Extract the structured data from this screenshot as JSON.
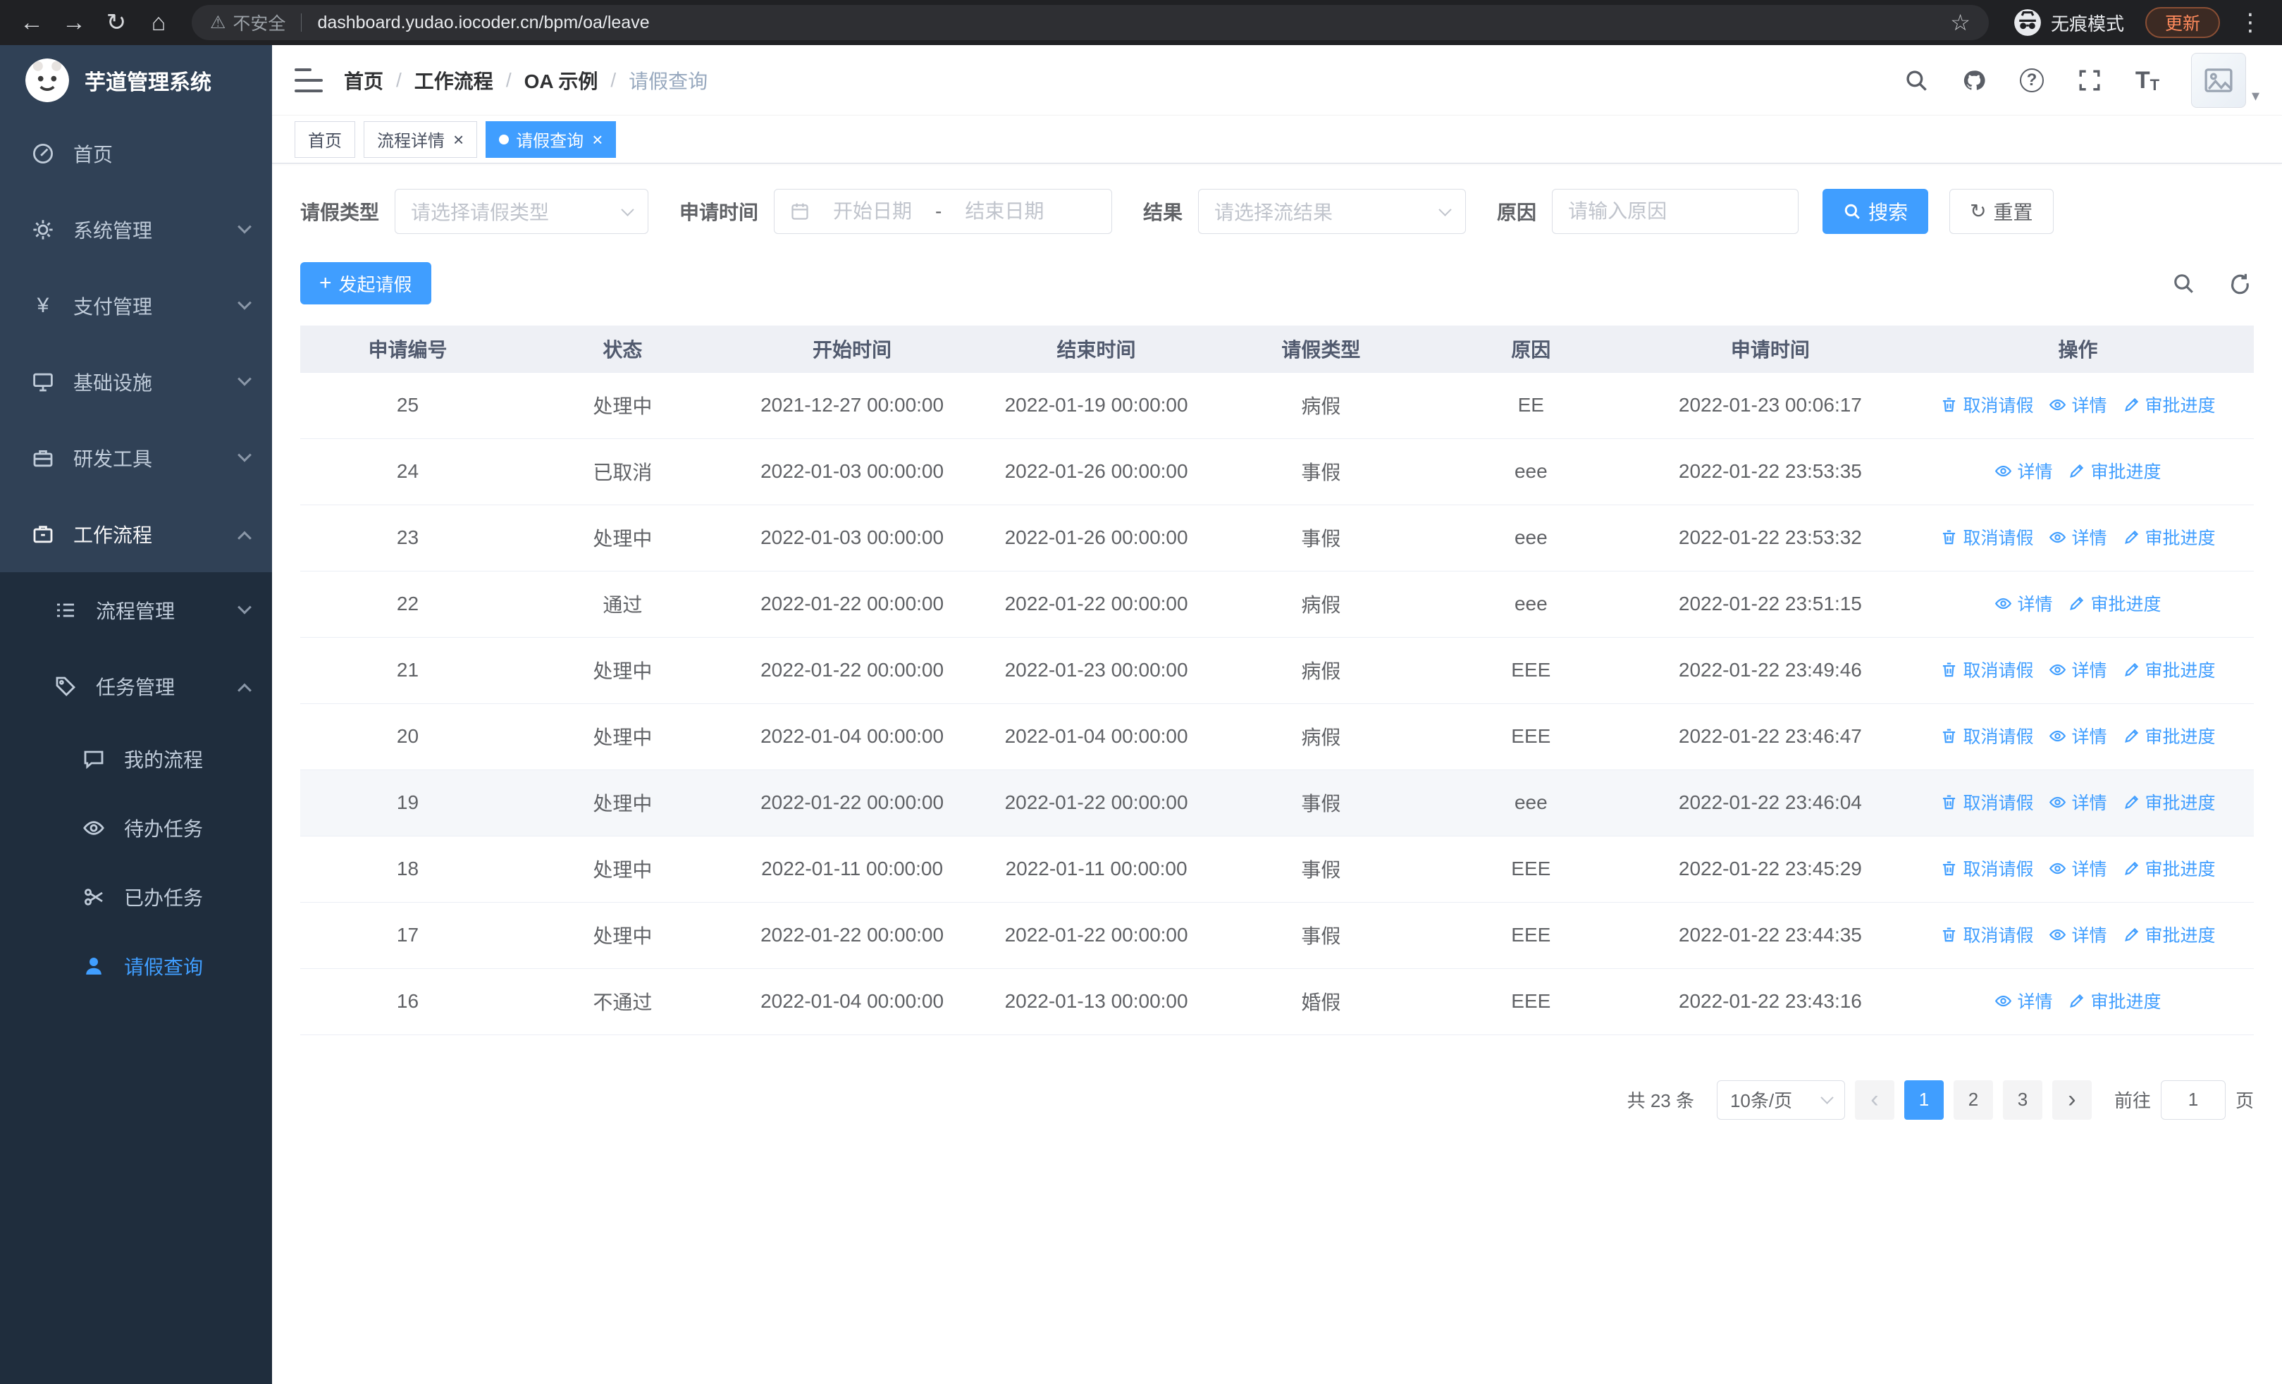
{
  "browser": {
    "security_label": "不安全",
    "url": "dashboard.yudao.iocoder.cn/bpm/oa/leave",
    "incognito_label": "无痕模式",
    "update_label": "更新"
  },
  "app": {
    "title": "芋道管理系统"
  },
  "icons": {
    "back": "←",
    "forward": "→",
    "reload": "↻",
    "home": "⌂",
    "warning": "⚠",
    "star": "☆",
    "more": "⋮",
    "close": "×",
    "prev": "‹",
    "next": "›",
    "plus": "+",
    "yen": "¥",
    "question": "?",
    "caret": "▾",
    "font_big": "T",
    "font_small": "T",
    "refresh": "↻"
  },
  "sidebar": {
    "items": [
      {
        "label": "首页"
      },
      {
        "label": "系统管理"
      },
      {
        "label": "支付管理"
      },
      {
        "label": "基础设施"
      },
      {
        "label": "研发工具"
      },
      {
        "label": "工作流程"
      }
    ],
    "sub_items": [
      {
        "label": "流程管理"
      },
      {
        "label": "任务管理"
      }
    ],
    "task_items": [
      {
        "label": "我的流程"
      },
      {
        "label": "待办任务"
      },
      {
        "label": "已办任务"
      },
      {
        "label": "请假查询"
      }
    ]
  },
  "breadcrumb": {
    "items": [
      "首页",
      "工作流程",
      "OA 示例",
      "请假查询"
    ],
    "separator": "/"
  },
  "tabs": [
    {
      "label": "首页",
      "closable": false,
      "active": false
    },
    {
      "label": "流程详情",
      "closable": true,
      "active": false
    },
    {
      "label": "请假查询",
      "closable": true,
      "active": true
    }
  ],
  "filters": {
    "leave_type_label": "请假类型",
    "leave_type_placeholder": "请选择请假类型",
    "apply_time_label": "申请时间",
    "date_start_placeholder": "开始日期",
    "date_separator": "-",
    "date_end_placeholder": "结束日期",
    "result_label": "结果",
    "result_placeholder": "请选择流结果",
    "reason_label": "原因",
    "reason_placeholder": "请输入原因",
    "search_label": "搜索",
    "reset_label": "重置"
  },
  "toolbar": {
    "create_label": "发起请假"
  },
  "table": {
    "columns": [
      "申请编号",
      "状态",
      "开始时间",
      "结束时间",
      "请假类型",
      "原因",
      "申请时间",
      "操作"
    ],
    "actions": {
      "cancel": "取消请假",
      "detail": "详情",
      "progress": "审批进度"
    },
    "rows": [
      {
        "id": "25",
        "status": "处理中",
        "start": "2021-12-27 00:00:00",
        "end": "2022-01-19 00:00:00",
        "type": "病假",
        "reason": "EE",
        "applied": "2022-01-23 00:06:17",
        "cancelable": true,
        "highlighted": false
      },
      {
        "id": "24",
        "status": "已取消",
        "start": "2022-01-03 00:00:00",
        "end": "2022-01-26 00:00:00",
        "type": "事假",
        "reason": "eee",
        "applied": "2022-01-22 23:53:35",
        "cancelable": false,
        "highlighted": false
      },
      {
        "id": "23",
        "status": "处理中",
        "start": "2022-01-03 00:00:00",
        "end": "2022-01-26 00:00:00",
        "type": "事假",
        "reason": "eee",
        "applied": "2022-01-22 23:53:32",
        "cancelable": true,
        "highlighted": false
      },
      {
        "id": "22",
        "status": "通过",
        "start": "2022-01-22 00:00:00",
        "end": "2022-01-22 00:00:00",
        "type": "病假",
        "reason": "eee",
        "applied": "2022-01-22 23:51:15",
        "cancelable": false,
        "highlighted": false
      },
      {
        "id": "21",
        "status": "处理中",
        "start": "2022-01-22 00:00:00",
        "end": "2022-01-23 00:00:00",
        "type": "病假",
        "reason": "EEE",
        "applied": "2022-01-22 23:49:46",
        "cancelable": true,
        "highlighted": false
      },
      {
        "id": "20",
        "status": "处理中",
        "start": "2022-01-04 00:00:00",
        "end": "2022-01-04 00:00:00",
        "type": "病假",
        "reason": "EEE",
        "applied": "2022-01-22 23:46:47",
        "cancelable": true,
        "highlighted": false
      },
      {
        "id": "19",
        "status": "处理中",
        "start": "2022-01-22 00:00:00",
        "end": "2022-01-22 00:00:00",
        "type": "事假",
        "reason": "eee",
        "applied": "2022-01-22 23:46:04",
        "cancelable": true,
        "highlighted": true
      },
      {
        "id": "18",
        "status": "处理中",
        "start": "2022-01-11 00:00:00",
        "end": "2022-01-11 00:00:00",
        "type": "事假",
        "reason": "EEE",
        "applied": "2022-01-22 23:45:29",
        "cancelable": true,
        "highlighted": false
      },
      {
        "id": "17",
        "status": "处理中",
        "start": "2022-01-22 00:00:00",
        "end": "2022-01-22 00:00:00",
        "type": "事假",
        "reason": "EEE",
        "applied": "2022-01-22 23:44:35",
        "cancelable": true,
        "highlighted": false
      },
      {
        "id": "16",
        "status": "不通过",
        "start": "2022-01-04 00:00:00",
        "end": "2022-01-13 00:00:00",
        "type": "婚假",
        "reason": "EEE",
        "applied": "2022-01-22 23:43:16",
        "cancelable": false,
        "highlighted": false
      }
    ]
  },
  "pagination": {
    "total": "共 23 条",
    "page_size": "10条/页",
    "pages": [
      "1",
      "2",
      "3"
    ],
    "active_page": "1",
    "goto_label": "前往",
    "goto_value": "1",
    "goto_suffix": "页"
  },
  "colors": {
    "accent": "#409EFF",
    "sidebar_bg": "#304156",
    "submenu_bg": "#1F2D3D",
    "header_bg": "#EEF0F5"
  }
}
